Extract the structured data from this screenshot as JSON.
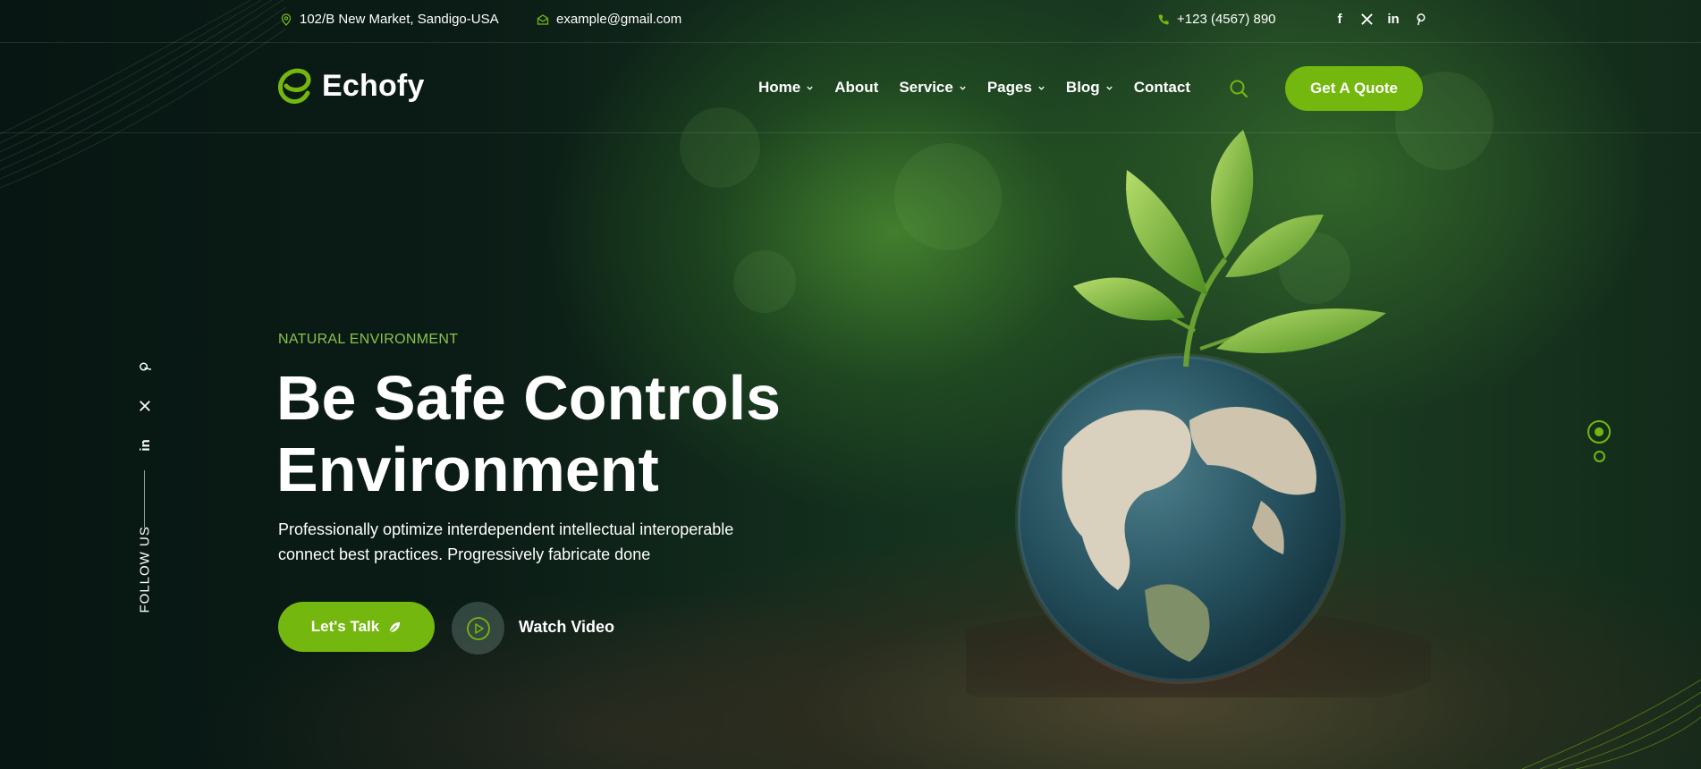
{
  "topbar": {
    "address": "102/B New Market, Sandigo-USA",
    "email": "example@gmail.com",
    "phone": "+123 (4567) 890",
    "socials": [
      "facebook-icon",
      "x-icon",
      "linkedin-icon",
      "pinterest-icon"
    ]
  },
  "header": {
    "logo_text": "Echofy",
    "nav": [
      {
        "label": "Home",
        "dropdown": true
      },
      {
        "label": "About",
        "dropdown": false
      },
      {
        "label": "Service",
        "dropdown": true
      },
      {
        "label": "Pages",
        "dropdown": true
      },
      {
        "label": "Blog",
        "dropdown": true
      },
      {
        "label": "Contact",
        "dropdown": false
      }
    ],
    "quote_button": "Get A Quote"
  },
  "follow": {
    "label": "FOLLOW US",
    "icons": [
      "pinterest-icon",
      "x-icon",
      "linkedin-icon"
    ]
  },
  "hero": {
    "eyebrow": "NATURAL ENVIRONMENT",
    "title_line1": "Be Safe Controls",
    "title_line2": "Environment",
    "desc_line1": "Professionally optimize interdependent intellectual interoperable",
    "desc_line2": "connect best practices. Progressively fabricate done",
    "talk_button": "Let's Talk",
    "watch_label": "Watch Video"
  },
  "slider": {
    "slides": 2,
    "active": 1
  },
  "colors": {
    "accent": "#74b70f",
    "eyebrow": "#8bc34a",
    "background": "#0a1a14"
  }
}
